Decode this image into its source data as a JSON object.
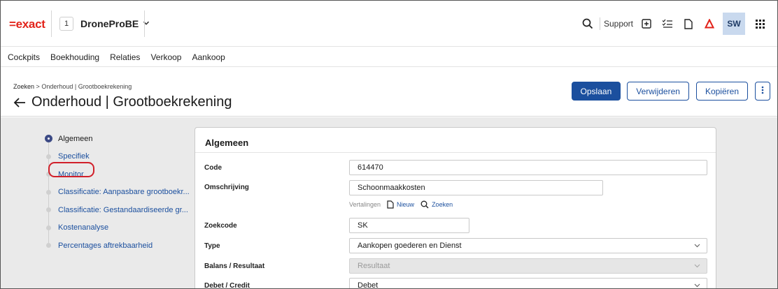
{
  "app": {
    "logo": "=exact",
    "company_number": "1",
    "company_name": "DroneProBE",
    "support_label": "Support",
    "avatar_initials": "SW",
    "colors": {
      "brand_red": "#e2231a",
      "primary_blue": "#1b4f9e",
      "highlight_red": "#d1202a"
    }
  },
  "menu": [
    "Cockpits",
    "Boekhouding",
    "Relaties",
    "Verkoop",
    "Aankoop"
  ],
  "header": {
    "breadcrumb_root": "Zoeken",
    "breadcrumb_sep": ">",
    "breadcrumb_current": "Onderhoud | Grootboekrekening",
    "title": "Onderhoud | Grootboekrekening",
    "actions": {
      "save": "Opslaan",
      "delete": "Verwijderen",
      "copy": "Kopiëren"
    }
  },
  "sidenav": [
    "Algemeen",
    "Specifiek",
    "Monitor",
    "Classificatie: Aanpasbare grootboekr...",
    "Classificatie: Gestandaardiseerde gr...",
    "Kostenanalyse",
    "Percentages aftrekbaarheid"
  ],
  "form": {
    "section_title": "Algemeen",
    "code_label": "Code",
    "code_value": "614470",
    "omschrijving_label": "Omschrijving",
    "omschrijving_value": "Schoonmaakkosten",
    "vertalingen_label": "Vertalingen",
    "nieuw_label": "Nieuw",
    "zoeken_label": "Zoeken",
    "zoekcode_label": "Zoekcode",
    "zoekcode_value": "SK",
    "type_label": "Type",
    "type_value": "Aankopen goederen en Dienst",
    "balans_label": "Balans / Resultaat",
    "balans_value": "Resultaat",
    "debet_label": "Debet / Credit",
    "debet_value": "Debet"
  }
}
